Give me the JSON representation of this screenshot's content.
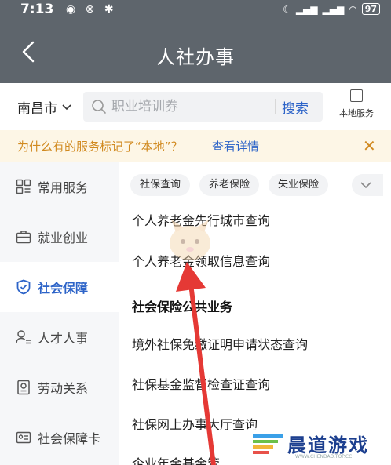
{
  "status_bar": {
    "time": "7:13",
    "battery": "97"
  },
  "header": {
    "title": "人社办事"
  },
  "search": {
    "city": "南昌市",
    "placeholder": "职业培训券",
    "button": "搜索",
    "local_service": "本地服务"
  },
  "notice": {
    "text": "为什么有的服务标记了“本地”？",
    "link": "查看详情"
  },
  "sidebar": {
    "items": [
      {
        "label": "常用服务",
        "icon": "grid-icon",
        "active": false
      },
      {
        "label": "就业创业",
        "icon": "briefcase-icon",
        "active": false
      },
      {
        "label": "社会保障",
        "icon": "shield-icon",
        "active": true
      },
      {
        "label": "人才人事",
        "icon": "person-list-icon",
        "active": false
      },
      {
        "label": "劳动关系",
        "icon": "badge-icon",
        "active": false
      },
      {
        "label": "社会保障卡",
        "icon": "id-card-icon",
        "active": false
      }
    ]
  },
  "main": {
    "chips": [
      "社保查询",
      "养老保险",
      "失业保险"
    ],
    "items_top": [
      "个人养老金先行城市查询",
      "个人养老金领取信息查询"
    ],
    "section_title": "社会保险公共业务",
    "items_section": [
      "境外社保免缴证明申请状态查询",
      "社保基金监督检查证查询",
      "社保网上办事大厅查询",
      "企业年金基金管"
    ]
  },
  "watermark": {
    "text": "晨道游戏",
    "sub": "WWW.CHENDAO.TOP.CC"
  },
  "colors": {
    "header_bg": "#5e656c",
    "accent": "#2c63c8",
    "notice_bg": "#fdf6e6",
    "notice_text": "#d18a20",
    "arrow": "#e53935"
  }
}
